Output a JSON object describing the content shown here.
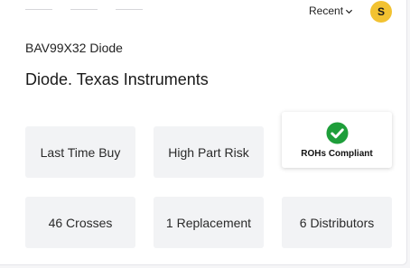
{
  "header": {
    "recent_label": "Recent",
    "avatar_initial": "S"
  },
  "part": {
    "number": "BAV99X32 Diode",
    "description": "Diode. Texas Instruments"
  },
  "status_tiles": {
    "lifecycle": "Last Time Buy",
    "risk": "High Part Risk",
    "rohs": "ROHs Compliant"
  },
  "stat_tiles": {
    "crosses": "46 Crosses",
    "replacements": "1 Replacement",
    "distributors": "6 Distributors"
  },
  "colors": {
    "avatar": "#f2c231",
    "check": "#1e9e3a",
    "tile_bg": "#f2f3f5"
  }
}
